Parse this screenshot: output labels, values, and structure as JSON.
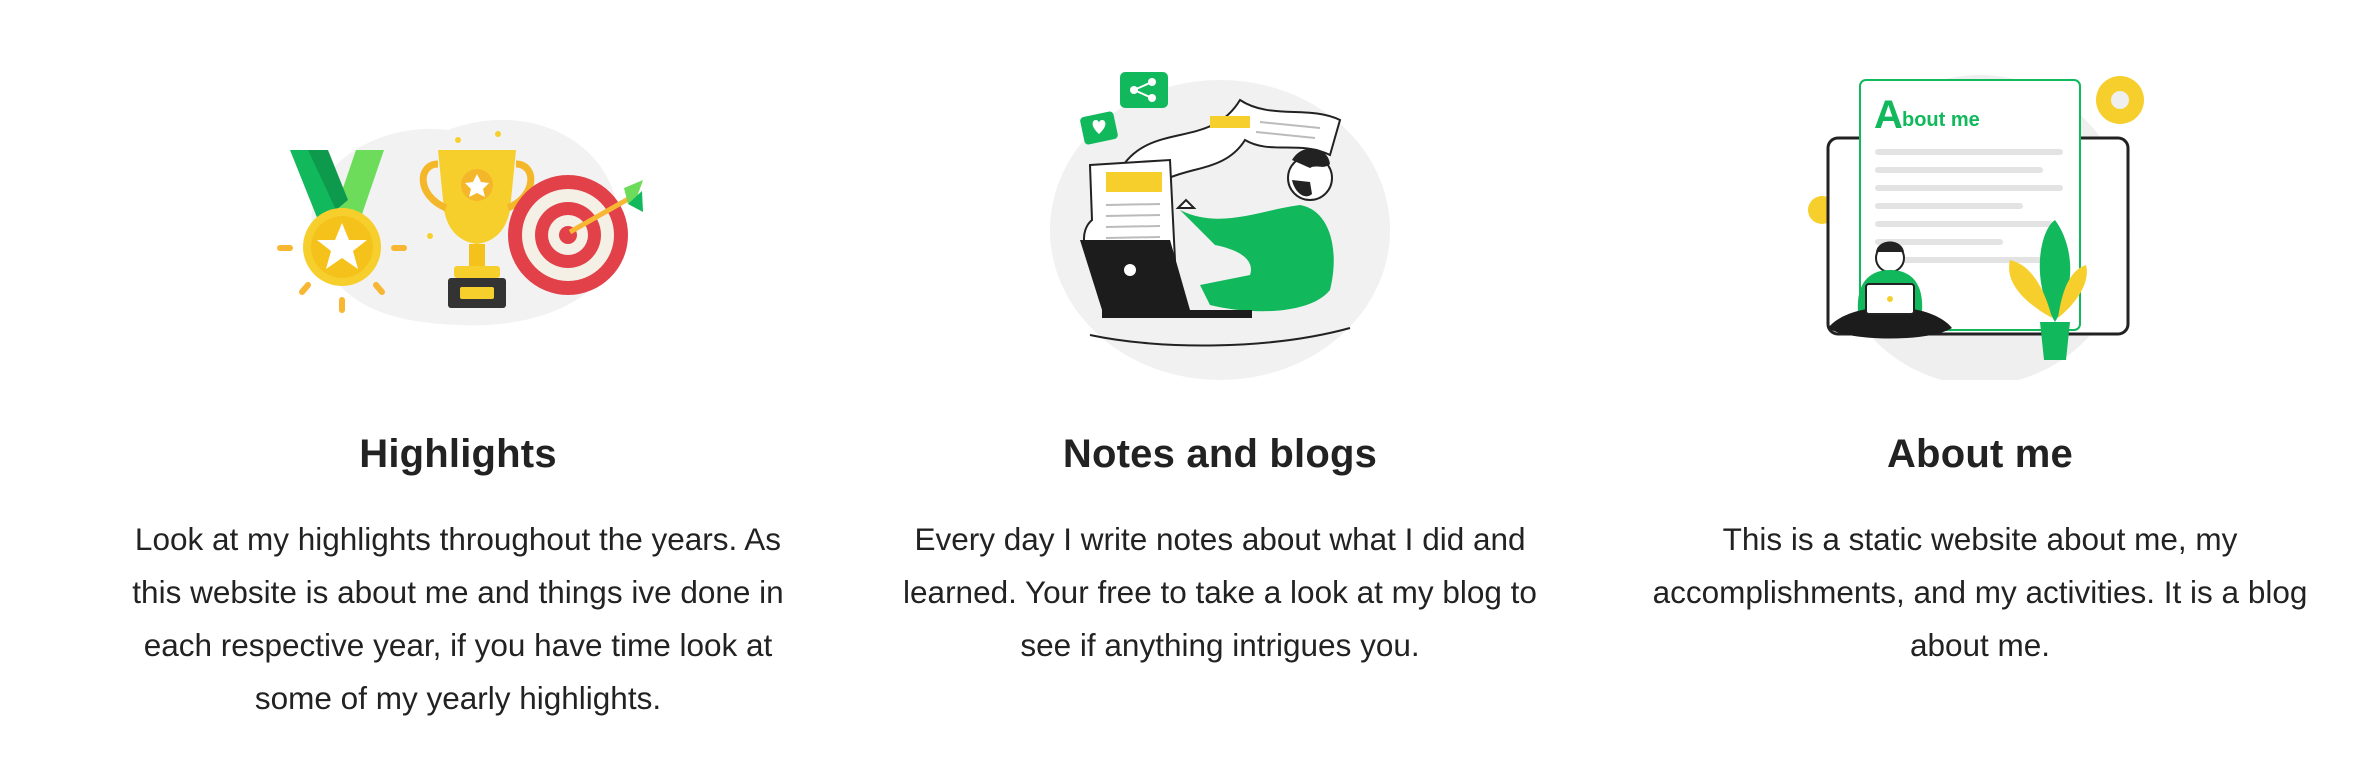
{
  "features": [
    {
      "icon": "highlights-illustration",
      "title": "Highlights",
      "text": "Look at my highlights throughout the years. As this website is about me and things ive done in each respective year, if you have time look at some of my yearly highlights."
    },
    {
      "icon": "notes-blogs-illustration",
      "title": "Notes and blogs",
      "text": "Every day I write notes about what I did and learned. Your free to take a look at my blog to see if anything intrigues you."
    },
    {
      "icon": "about-me-illustration",
      "title": "About me",
      "text": "This is a static website about me, my accomplishments, and my activities. It is a blog about me.",
      "illustration_heading": "About me"
    }
  ],
  "colors": {
    "accent_green": "#12b85c",
    "accent_yellow": "#f7cf2d",
    "target_red": "#e2414a",
    "text": "#222222"
  }
}
